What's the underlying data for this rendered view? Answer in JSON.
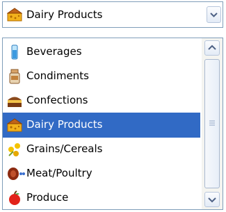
{
  "combo": {
    "selected_label": "Dairy Products",
    "selected_icon": "cheese-icon"
  },
  "list": {
    "items": [
      {
        "label": "Beverages",
        "icon": "glass-icon"
      },
      {
        "label": "Condiments",
        "icon": "jar-icon"
      },
      {
        "label": "Confections",
        "icon": "cake-icon"
      },
      {
        "label": "Dairy Products",
        "icon": "cheese-icon",
        "selected": true
      },
      {
        "label": "Grains/Cereals",
        "icon": "grain-icon"
      },
      {
        "label": "Meat/Poultry",
        "icon": "meat-icon"
      },
      {
        "label": "Produce",
        "icon": "apple-icon"
      }
    ]
  },
  "colors": {
    "selection": "#316ac5",
    "border": "#7f9db9"
  }
}
